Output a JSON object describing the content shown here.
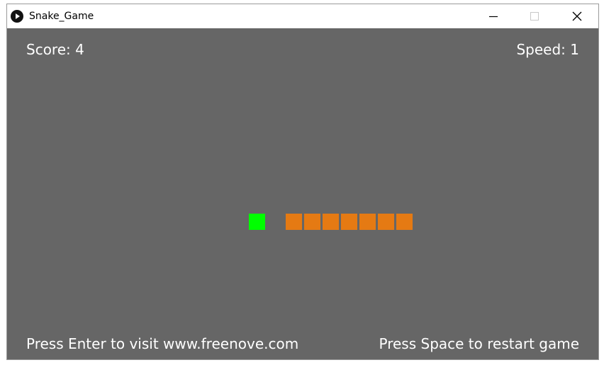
{
  "window": {
    "title": "Snake_Game",
    "app_icon": "play-circle-icon",
    "controls": {
      "minimize_icon": "minimize-icon",
      "maximize_icon": "maximize-icon",
      "close_icon": "close-icon"
    }
  },
  "hud": {
    "score_text": "Score: 4",
    "speed_text": "Speed: 1",
    "score": 4,
    "speed": 1
  },
  "instructions": {
    "enter_hint": "Press Enter to visit www.freenove.com",
    "space_hint": "Press Space to restart game"
  },
  "game": {
    "grid_cell": 26,
    "food_cell": {
      "col": 0,
      "row": 0
    },
    "snake_segments": 7,
    "colors": {
      "background": "#666666",
      "food": "#00ff00",
      "snake": "#e57a13",
      "text": "#ffffff"
    }
  }
}
